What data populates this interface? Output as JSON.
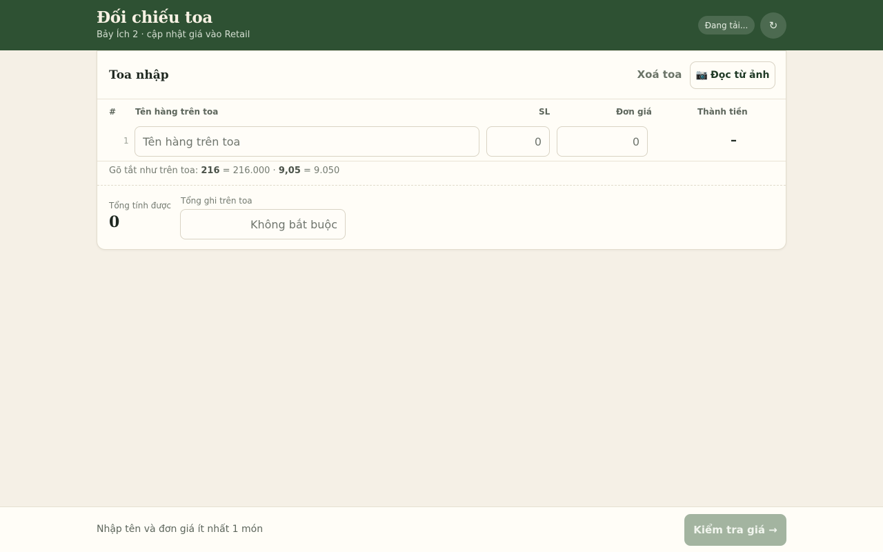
{
  "header": {
    "title": "Đối chiếu toa",
    "subtitle": "Bảy Ích 2 · cập nhật giá vào Retail",
    "status": "Đang tải...",
    "refresh_icon": "↻"
  },
  "card": {
    "title": "Toa nhập",
    "clear_label": "Xoá toa",
    "ocr_icon": "📷",
    "ocr_label": "Đọc từ ảnh",
    "columns": [
      "#",
      "Tên hàng trên toa",
      "SL",
      "Đơn giá",
      "Thành tiền"
    ],
    "rows": [
      {
        "index": "1",
        "name_value": "",
        "name_placeholder": "Tên hàng trên toa",
        "qty_value": "",
        "qty_placeholder": "0",
        "price_value": "",
        "price_placeholder": "0",
        "amount": "–"
      }
    ],
    "hint": {
      "prefix": "Gõ tắt như trên toa: ",
      "ex1_short": "216",
      "ex1_full": " = 216.000 · ",
      "ex2_short": "9,05",
      "ex2_full": " = 9.050"
    },
    "total_label": "Tổng tính được",
    "total_value": "0",
    "written_total_label": "Tổng ghi trên toa",
    "written_total_placeholder": "Không bắt buộc"
  },
  "footer": {
    "message": "Nhập tên và đơn giá ít nhất 1 món",
    "check_label": "Kiểm tra giá →"
  }
}
